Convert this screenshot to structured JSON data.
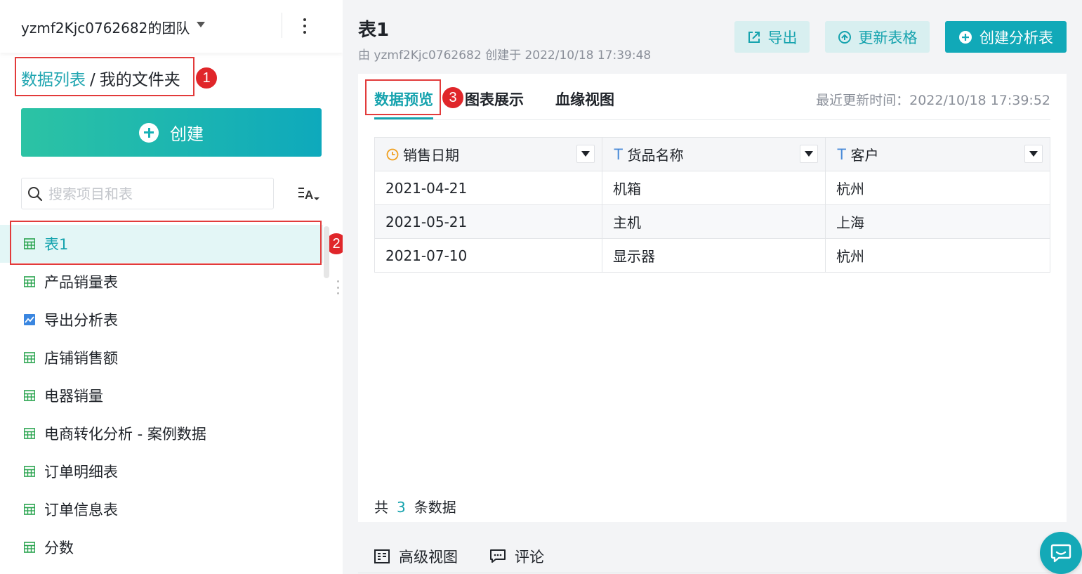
{
  "sidebar": {
    "team_name": "yzmf2Kjc0762682的团队",
    "breadcrumb": {
      "root": "数据列表",
      "separator": "/",
      "current": "我的文件夹"
    },
    "create_label": "创建",
    "search_placeholder": "搜索项目和表",
    "items": [
      {
        "label": "表1",
        "icon": "table-icon"
      },
      {
        "label": "产品销量表",
        "icon": "table-icon"
      },
      {
        "label": "导出分析表",
        "icon": "analysis-chart-icon"
      },
      {
        "label": "店铺销售额",
        "icon": "table-icon"
      },
      {
        "label": "电器销量",
        "icon": "table-icon"
      },
      {
        "label": "电商转化分析 - 案例数据",
        "icon": "table-icon"
      },
      {
        "label": "订单明细表",
        "icon": "table-icon"
      },
      {
        "label": "订单信息表",
        "icon": "table-icon"
      },
      {
        "label": "分数",
        "icon": "table-icon"
      }
    ]
  },
  "annotations": [
    "1",
    "2",
    "3"
  ],
  "main": {
    "title": "表1",
    "subtitle": "由 yzmf2Kjc0762682 创建于 2022/10/18 17:39:48",
    "buttons": {
      "export": "导出",
      "update": "更新表格",
      "create_analysis": "创建分析表"
    },
    "tabs": [
      "数据预览",
      "图表展示",
      "血缘视图"
    ],
    "last_update": "最近更新时间：2022/10/18 17:39:52",
    "table": {
      "columns": [
        {
          "label": "销售日期",
          "type": "date"
        },
        {
          "label": "货品名称",
          "type": "text"
        },
        {
          "label": "客户",
          "type": "text"
        }
      ],
      "rows": [
        [
          "2021-04-21",
          "机箱",
          "杭州"
        ],
        [
          "2021-05-21",
          "主机",
          "上海"
        ],
        [
          "2021-07-10",
          "显示器",
          "杭州"
        ]
      ]
    },
    "count": {
      "prefix": "共",
      "value": "3",
      "suffix": "条数据"
    },
    "bottom": {
      "advanced_view": "高级视图",
      "comments": "评论"
    }
  },
  "colors": {
    "accent": "#16a3ae",
    "annotation": "#e0262a",
    "active_bg": "#e3f6f6"
  }
}
